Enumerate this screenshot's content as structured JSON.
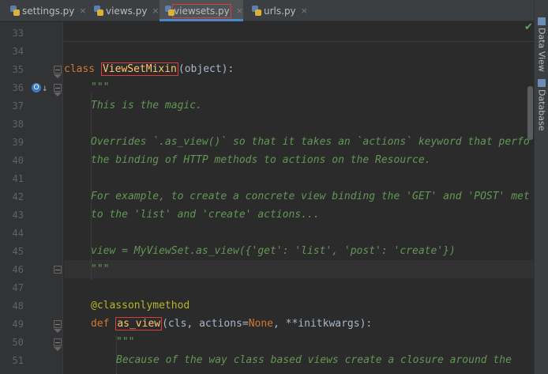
{
  "tabs": [
    {
      "label": "settings.py",
      "active": false
    },
    {
      "label": "views.py",
      "active": false
    },
    {
      "label": "viewsets.py",
      "active": true
    },
    {
      "label": "urls.py",
      "active": false
    }
  ],
  "tab_close_glyph": "×",
  "right_tools": [
    "Data View",
    "Database"
  ],
  "line_numbers": [
    "33",
    "34",
    "35",
    "36",
    "37",
    "38",
    "39",
    "40",
    "41",
    "42",
    "43",
    "44",
    "45",
    "46",
    "47",
    "48",
    "49",
    "50",
    "51"
  ],
  "code": {
    "l35_kw": "class",
    "l35_name": "ViewSetMixin",
    "l35_rest": "(object):",
    "l36": "\"\"\"",
    "l37": "This is the magic.",
    "l39": "Overrides `.as_view()` so that it takes an `actions` keyword that perfo",
    "l40": "the binding of HTTP methods to actions on the Resource.",
    "l42": "For example, to create a concrete view binding the 'GET' and 'POST' met",
    "l43": "to the 'list' and 'create' actions...",
    "l45": "view = MyViewSet.as_view({'get': 'list', 'post': 'create'})",
    "l46": "\"\"\"",
    "l48": "@classonlymethod",
    "l49_kw": "def",
    "l49_name": "as_view",
    "l49_p1": "(cls, actions=",
    "l49_none": "None",
    "l49_p2": ", **initkwargs):",
    "l50": "\"\"\"",
    "l51": "Because of the way class based views create a closure around the"
  },
  "colors": {
    "background": "#2b2b2b",
    "keyword": "#cc7832",
    "function_name": "#ffc66d",
    "docstring": "#629755",
    "decorator": "#bbb529",
    "highlight_box": "#e03b3b"
  },
  "icons": [
    "python-file-icon",
    "close-icon",
    "implements-icon",
    "fold-icon",
    "check-icon"
  ]
}
